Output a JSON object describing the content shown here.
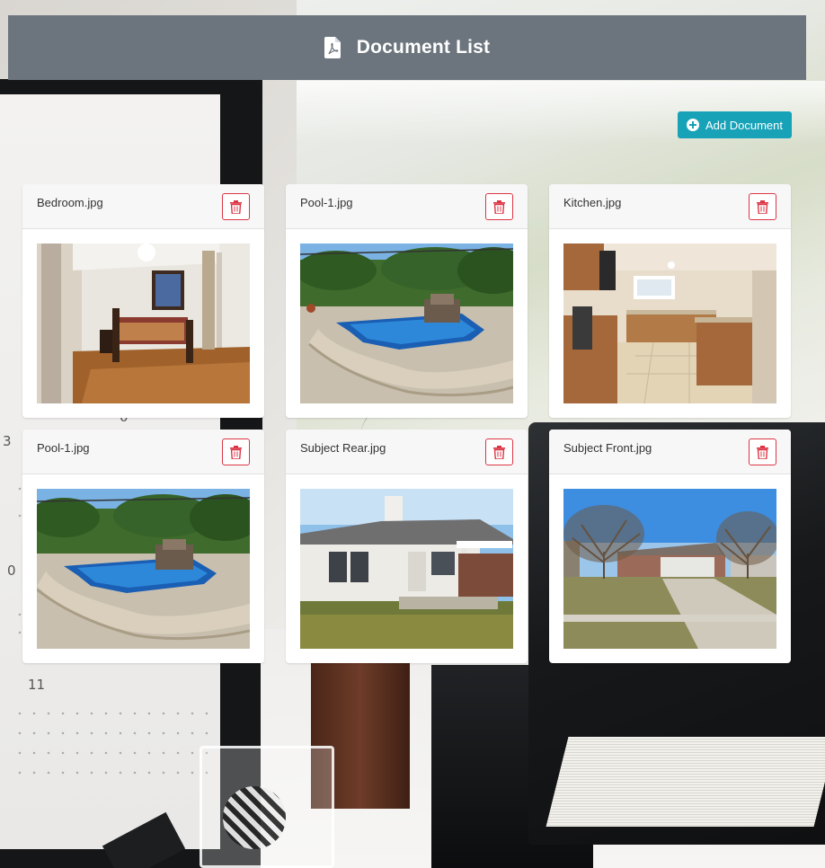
{
  "header": {
    "title": "Document List",
    "icon": "file-pdf-icon"
  },
  "toolbar": {
    "add_label": "Add Document",
    "add_icon": "plus-circle-icon"
  },
  "documents": [
    {
      "name": "Bedroom.jpg",
      "thumbnail": "bedroom"
    },
    {
      "name": "Pool-1.jpg",
      "thumbnail": "pool"
    },
    {
      "name": "Kitchen.jpg",
      "thumbnail": "kitchen"
    },
    {
      "name": "Pool-1.jpg",
      "thumbnail": "pool"
    },
    {
      "name": "Subject Rear.jpg",
      "thumbnail": "house-rear"
    },
    {
      "name": "Subject Front.jpg",
      "thumbnail": "house-front"
    }
  ],
  "background": {
    "calendar_numbers": [
      "0",
      "3",
      "0",
      "11"
    ]
  },
  "colors": {
    "header": "#6c757d",
    "accent": "#17a2b8",
    "danger": "#dc3545"
  }
}
